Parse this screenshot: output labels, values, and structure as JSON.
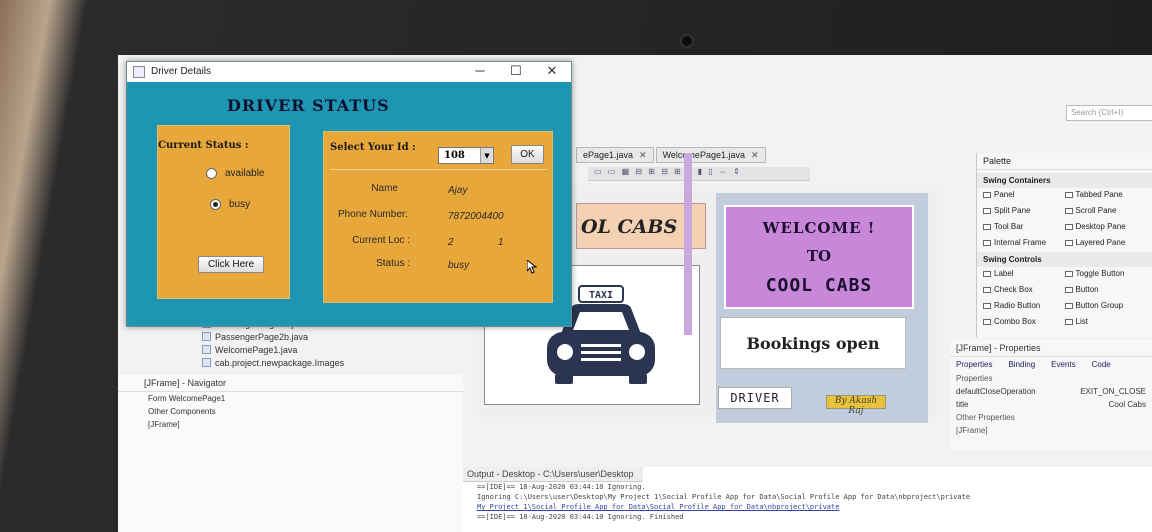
{
  "window": {
    "title": "Driver Details",
    "minimize": "─",
    "maximize": "☐",
    "close": "✕",
    "heading": "DRIVER STATUS",
    "current_status_label": "Current Status :",
    "radio_available": "available",
    "radio_busy": "busy",
    "selected_status": "busy",
    "click_button": "Click Here",
    "select_id_label": "Select Your Id :",
    "selected_id": "108",
    "ok_button": "OK",
    "fields": {
      "name_label": "Name",
      "name_value": "Ajay",
      "phone_label": "Phone Number:",
      "phone_value": "7872004400",
      "loc_label": "Current Loc :",
      "loc_value_1": "2",
      "loc_value_2": "1",
      "status_label": "Status :",
      "status_value": "busy"
    }
  },
  "ide": {
    "search_placeholder": "Search (Ctrl+I)",
    "tabs": [
      {
        "label": "ePage1.java"
      },
      {
        "label": "WelcomePage1.java"
      }
    ],
    "design": {
      "cool_cabs_partial": "OL CABS",
      "taxi_sign": "TAXI",
      "welcome": "WELCOME !",
      "to": "TO",
      "cool_cabs": "COOL CABS",
      "bookings": "Bookings open",
      "driver_button": "DRIVER",
      "byline": "By Akash Raj"
    },
    "palette": {
      "title": "Palette",
      "cat_containers": "Swing Containers",
      "containers": [
        "Panel",
        "Tabbed Pane",
        "Split Pane",
        "Scroll Pane",
        "Tool Bar",
        "Desktop Pane",
        "Internal Frame",
        "Layered Pane"
      ],
      "cat_controls": "Swing Controls",
      "controls": [
        "Label",
        "Toggle Button",
        "Check Box",
        "Button",
        "Radio Button",
        "Button Group",
        "Combo Box",
        "List"
      ]
    },
    "properties": {
      "title": "[JFrame] - Properties",
      "tabs": [
        "Properties",
        "Binding",
        "Events",
        "Code"
      ],
      "section": "Properties",
      "rows": [
        {
          "key": "defaultCloseOperation",
          "value": "EXIT_ON_CLOSE"
        },
        {
          "key": "title",
          "value": "Cool Cabs"
        }
      ],
      "other": "Other Properties",
      "footer": "[JFrame]"
    },
    "tree": [
      "PassengerPage2a.java",
      "PassengerPage2b.java",
      "WelcomePage1.java",
      "cab.project.newpackage.Images"
    ],
    "navigator": {
      "title": "[JFrame] - Navigator",
      "items": [
        "Form WelcomePage1",
        "Other Components",
        "[JFrame]"
      ]
    },
    "output": {
      "title": "Output - Desktop - C:\\Users\\user\\Desktop",
      "lines": [
        "==[IDE]== 18-Aug-2020 03:44:10 Ignoring.",
        "Ignoring C:\\Users\\user\\Desktop\\My Project 1\\Social Profile App for Data\\Social Profile App for Data\\nbproject\\private",
        "My Project 1\\Social Profile App for Data\\Social Profile App for Data\\nbproject\\private",
        "==[IDE]== 18-Aug-2020 03:44:10 Ignoring.   Finished"
      ]
    }
  }
}
